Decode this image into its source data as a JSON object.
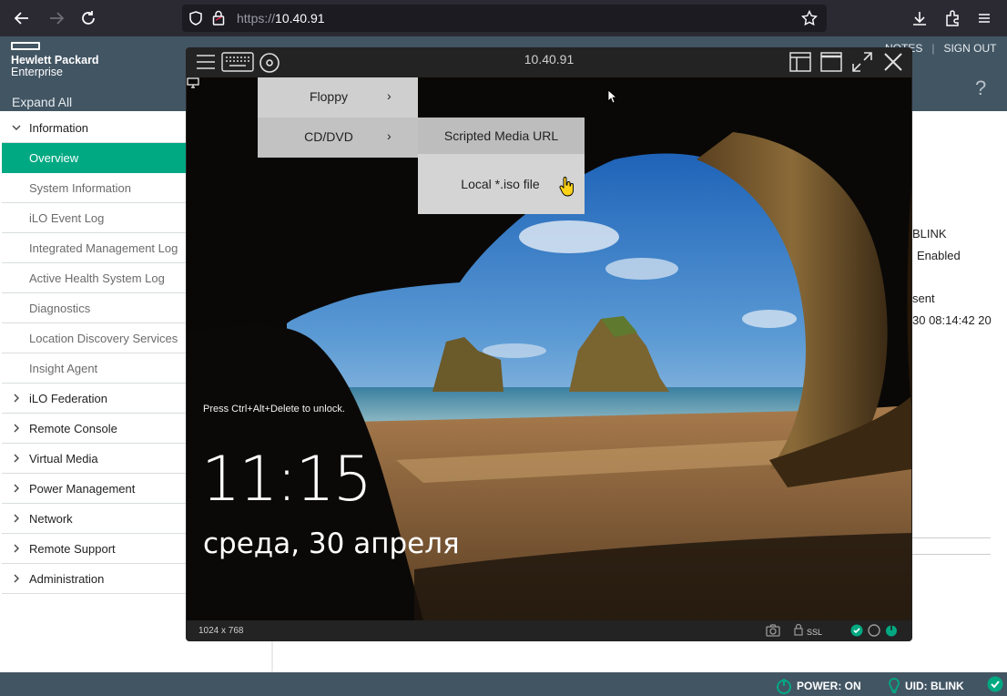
{
  "browser": {
    "url_prefix": "https://",
    "url_host": "10.40.91"
  },
  "ilo": {
    "logo_line1": "Hewlett Packard",
    "logo_line2": "Enterprise",
    "expand_all": "Expand All",
    "header_link_notes": "NOTES",
    "header_link_signout": "SIGN OUT",
    "help_icon": "?",
    "sidebar": [
      {
        "label": "Information",
        "type": "group",
        "expanded": true
      },
      {
        "label": "Overview",
        "type": "sub",
        "active": true
      },
      {
        "label": "System Information",
        "type": "sub"
      },
      {
        "label": "iLO Event Log",
        "type": "sub"
      },
      {
        "label": "Integrated Management Log",
        "type": "sub"
      },
      {
        "label": "Active Health System Log",
        "type": "sub"
      },
      {
        "label": "Diagnostics",
        "type": "sub"
      },
      {
        "label": "Location Discovery Services",
        "type": "sub"
      },
      {
        "label": "Insight Agent",
        "type": "sub"
      },
      {
        "label": "iLO Federation",
        "type": "group"
      },
      {
        "label": "Remote Console",
        "type": "group"
      },
      {
        "label": "Virtual Media",
        "type": "group"
      },
      {
        "label": "Power Management",
        "type": "group"
      },
      {
        "label": "Network",
        "type": "group"
      },
      {
        "label": "Remote Support",
        "type": "group"
      },
      {
        "label": "Administration",
        "type": "group"
      }
    ],
    "bg_texts": [
      "BLINK",
      "Enabled",
      "sent",
      "30 08:14:42 20"
    ],
    "status": {
      "power": "POWER: ON",
      "uid": "UID: BLINK"
    }
  },
  "console": {
    "title": "10.40.91",
    "lock_hint": "Press Ctrl+Alt+Delete to unlock.",
    "clock": "11:15",
    "date": "среда, 30 апреля",
    "resolution": "1024 x 768",
    "ssl": "SSL"
  },
  "media_menu": {
    "items": [
      {
        "label": "Floppy",
        "arrow": "›"
      },
      {
        "label": "CD/DVD",
        "arrow": "›"
      }
    ],
    "submenu": [
      {
        "label": "Scripted Media URL"
      },
      {
        "label": "Local *.iso file"
      }
    ]
  },
  "colors": {
    "hpe_green": "#01a982",
    "header_slate": "#425563",
    "browser_dark": "#2b2a33"
  }
}
